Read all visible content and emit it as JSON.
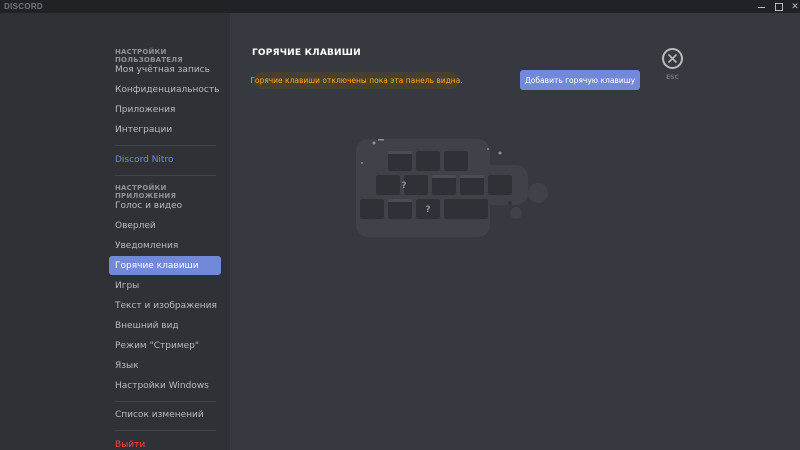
{
  "titlebar": {
    "app_logo": "DISCORD",
    "close_glyph": "✕"
  },
  "sidebar": {
    "user_settings_header": "НАСТРОЙКИ ПОЛЬЗОВАТЕЛЯ",
    "user_items": [
      "Моя учётная запись",
      "Конфиденциальность",
      "Приложения",
      "Интеграции"
    ],
    "nitro": "Discord Nitro",
    "app_settings_header": "НАСТРОЙКИ ПРИЛОЖЕНИЯ",
    "app_items": [
      "Голос и видео",
      "Оверлей",
      "Уведомления",
      "Горячие клавиши",
      "Игры",
      "Текст и изображения",
      "Внешний вид",
      "Режим \"Стример\"",
      "Язык",
      "Настройки Windows"
    ],
    "active_item": "Горячие клавиши",
    "changelog": "Список изменений",
    "logout": "Выйти"
  },
  "main": {
    "title": "ГОРЯЧИЕ КЛАВИШИ",
    "notice": "Горячие клавиши отключены пока эта панель видна.",
    "add_button": "Добавить горячую клавишу",
    "esc_label": "ESC",
    "key_question_glyph": "?"
  },
  "colors": {
    "accent": "#7289da",
    "warning": "#faa61a",
    "danger": "#f04747",
    "sidebar_bg": "#2f3136",
    "main_bg": "#36393f"
  }
}
